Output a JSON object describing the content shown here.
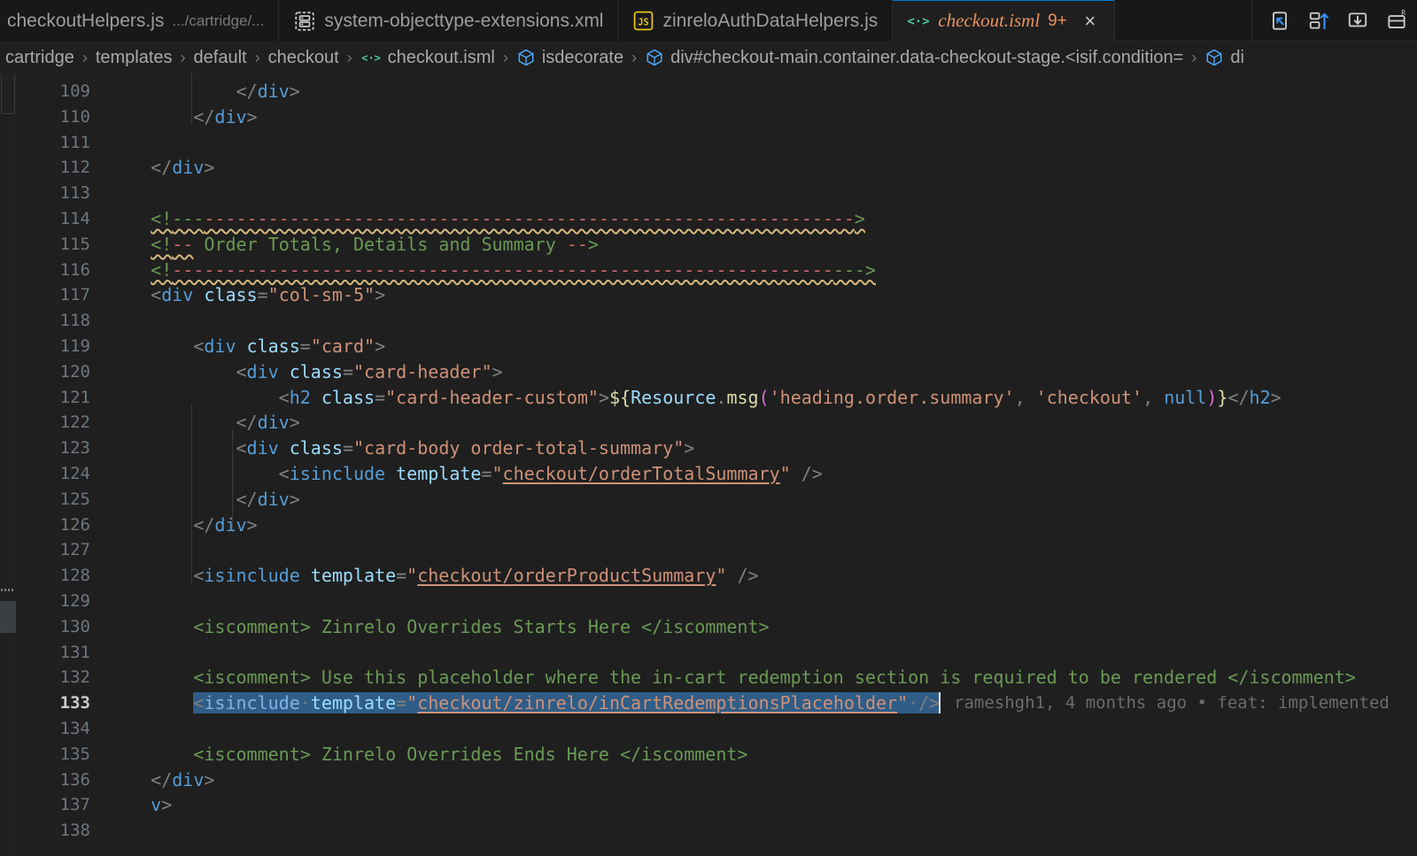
{
  "window": {
    "title": "checkout.isml"
  },
  "tabs": [
    {
      "name": "checkoutHelpers.js",
      "description": ".../cartridge/...",
      "icon": "js-file-icon",
      "active": false,
      "truncated_prefix": true
    },
    {
      "name": "system-objecttype-extensions.xml",
      "description": "",
      "icon": "xml-file-icon",
      "active": false
    },
    {
      "name": "zinreloAuthDataHelpers.js",
      "description": "",
      "icon": "js-file-icon",
      "active": false
    },
    {
      "name": "checkout.isml",
      "description": "",
      "icon": "isml-file-icon",
      "badge": "9+",
      "close": "×",
      "active": true
    }
  ],
  "tab_actions": [
    {
      "name": "split-editor-right-icon",
      "label": "Split Editor Right"
    },
    {
      "name": "split-editor-up-icon",
      "label": "Split Editor Up"
    },
    {
      "name": "split-editor-down-icon",
      "label": "Split Editor Down"
    },
    {
      "name": "more-actions-icon",
      "label": "More Actions..."
    }
  ],
  "breadcrumb": [
    {
      "label": "cartridge",
      "icon": "folder-icon"
    },
    {
      "label": "templates",
      "icon": "folder-icon"
    },
    {
      "label": "default",
      "icon": "folder-icon"
    },
    {
      "label": "checkout",
      "icon": "folder-icon"
    },
    {
      "label": "checkout.isml",
      "icon": "isml-file-icon"
    },
    {
      "label": "isdecorate",
      "icon": "symbol-cube-icon"
    },
    {
      "label": "div#checkout-main.container.data-checkout-stage.<isif.condition=",
      "icon": "symbol-cube-icon"
    },
    {
      "label": "di",
      "icon": "symbol-cube-icon"
    }
  ],
  "editor": {
    "first_line_number": 109,
    "current_line": 133,
    "blame": "rameshgh1, 4 months ago • feat: implemented",
    "lines": [
      {
        "n": 109,
        "text": "            </div>"
      },
      {
        "n": 110,
        "text": "        </div>"
      },
      {
        "n": 111,
        "text": ""
      },
      {
        "n": 112,
        "text": "    </div>"
      },
      {
        "n": 113,
        "text": ""
      },
      {
        "n": 114,
        "text": "    <!------------------------------------------------------------------>"
      },
      {
        "n": 115,
        "text": "    <!-- Order Totals, Details and Summary -->"
      },
      {
        "n": 116,
        "text": "    <!------------------------------------------------------------------>"
      },
      {
        "n": 117,
        "text": "    <div class=\"col-sm-5\">"
      },
      {
        "n": 118,
        "text": ""
      },
      {
        "n": 119,
        "text": "        <div class=\"card\">"
      },
      {
        "n": 120,
        "text": "            <div class=\"card-header\">"
      },
      {
        "n": 121,
        "text": "                <h2 class=\"card-header-custom\">${Resource.msg('heading.order.summary', 'checkout', null)}</h2>"
      },
      {
        "n": 122,
        "text": "            </div>"
      },
      {
        "n": 123,
        "text": "            <div class=\"card-body order-total-summary\">"
      },
      {
        "n": 124,
        "text": "                <isinclude template=\"checkout/orderTotalSummary\" />"
      },
      {
        "n": 125,
        "text": "            </div>"
      },
      {
        "n": 126,
        "text": "        </div>"
      },
      {
        "n": 127,
        "text": ""
      },
      {
        "n": 128,
        "text": "        <isinclude template=\"checkout/orderProductSummary\" />"
      },
      {
        "n": 129,
        "text": ""
      },
      {
        "n": 130,
        "text": "        <iscomment> Zinrelo Overrides Starts Here </iscomment>"
      },
      {
        "n": 131,
        "text": ""
      },
      {
        "n": 132,
        "text": "        <iscomment> Use this placeholder where the in-cart redemption section is required to be rendered </iscomment>"
      },
      {
        "n": 133,
        "text": "        <isinclude template=\"checkout/zinrelo/inCartRedemptionsPlaceholder\" />",
        "selected": true
      },
      {
        "n": 134,
        "text": ""
      },
      {
        "n": 135,
        "text": "        <iscomment> Zinrelo Overrides Ends Here </iscomment>"
      },
      {
        "n": 136,
        "text": "    </div>"
      },
      {
        "n": 137,
        "text": "    v>"
      },
      {
        "n": 138,
        "text": ""
      }
    ]
  },
  "colors": {
    "background": "#1f1f1f",
    "tabbar_background": "#181818",
    "active_tab_text": "#e8915f",
    "accent": "#0078d4",
    "selection": "#2f5d87",
    "tag": "#569cd6",
    "attribute": "#9cdcfe",
    "string": "#ce9178",
    "comment": "#6a9955",
    "comment_dash": "#d16969",
    "template_expr": "#dcdcaa",
    "squiggle_warning": "#d7ba7d",
    "line_number": "#6e7681"
  }
}
